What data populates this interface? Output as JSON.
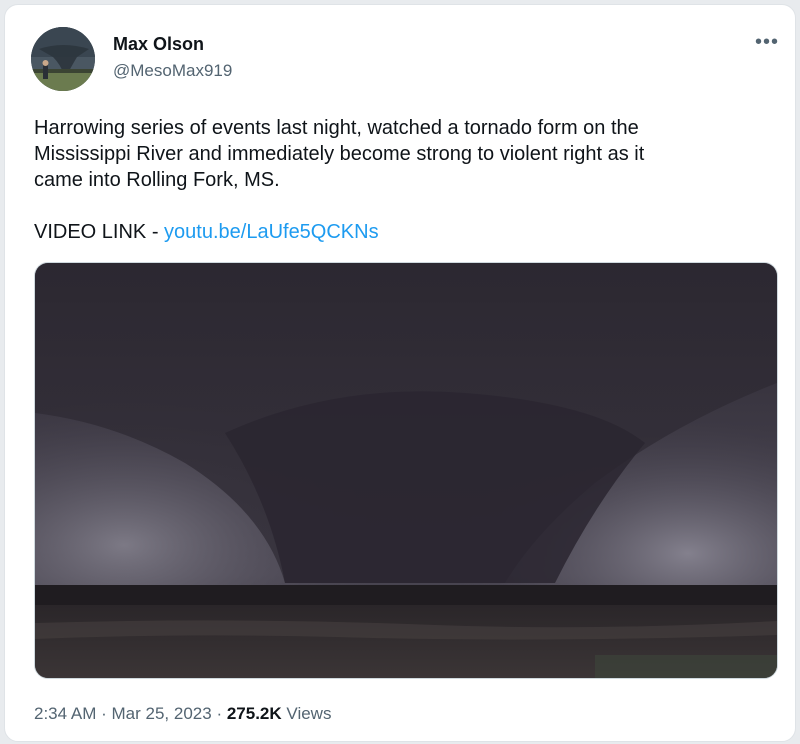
{
  "tweet": {
    "author": {
      "display_name": "Max Olson",
      "handle": "@MesoMax919"
    },
    "more_menu_icon": "more-horizontal-icon",
    "text": "Harrowing series of events last night, watched a tornado form on the\nMississippi River and immediately become strong to violent right as it\ncame into Rolling Fork, MS.",
    "video_link_label": "VIDEO LINK - ",
    "video_link_url_text": "youtu.be/LaUfe5QCKNs",
    "media_description": "tornado video still",
    "time": "2:34 AM",
    "separator": "·",
    "date": "Mar 25, 2023",
    "views_count": "275.2K",
    "views_label": "Views"
  },
  "colors": {
    "link": "#1d9bf0",
    "text_primary": "#0f1419",
    "text_secondary": "#536471"
  }
}
